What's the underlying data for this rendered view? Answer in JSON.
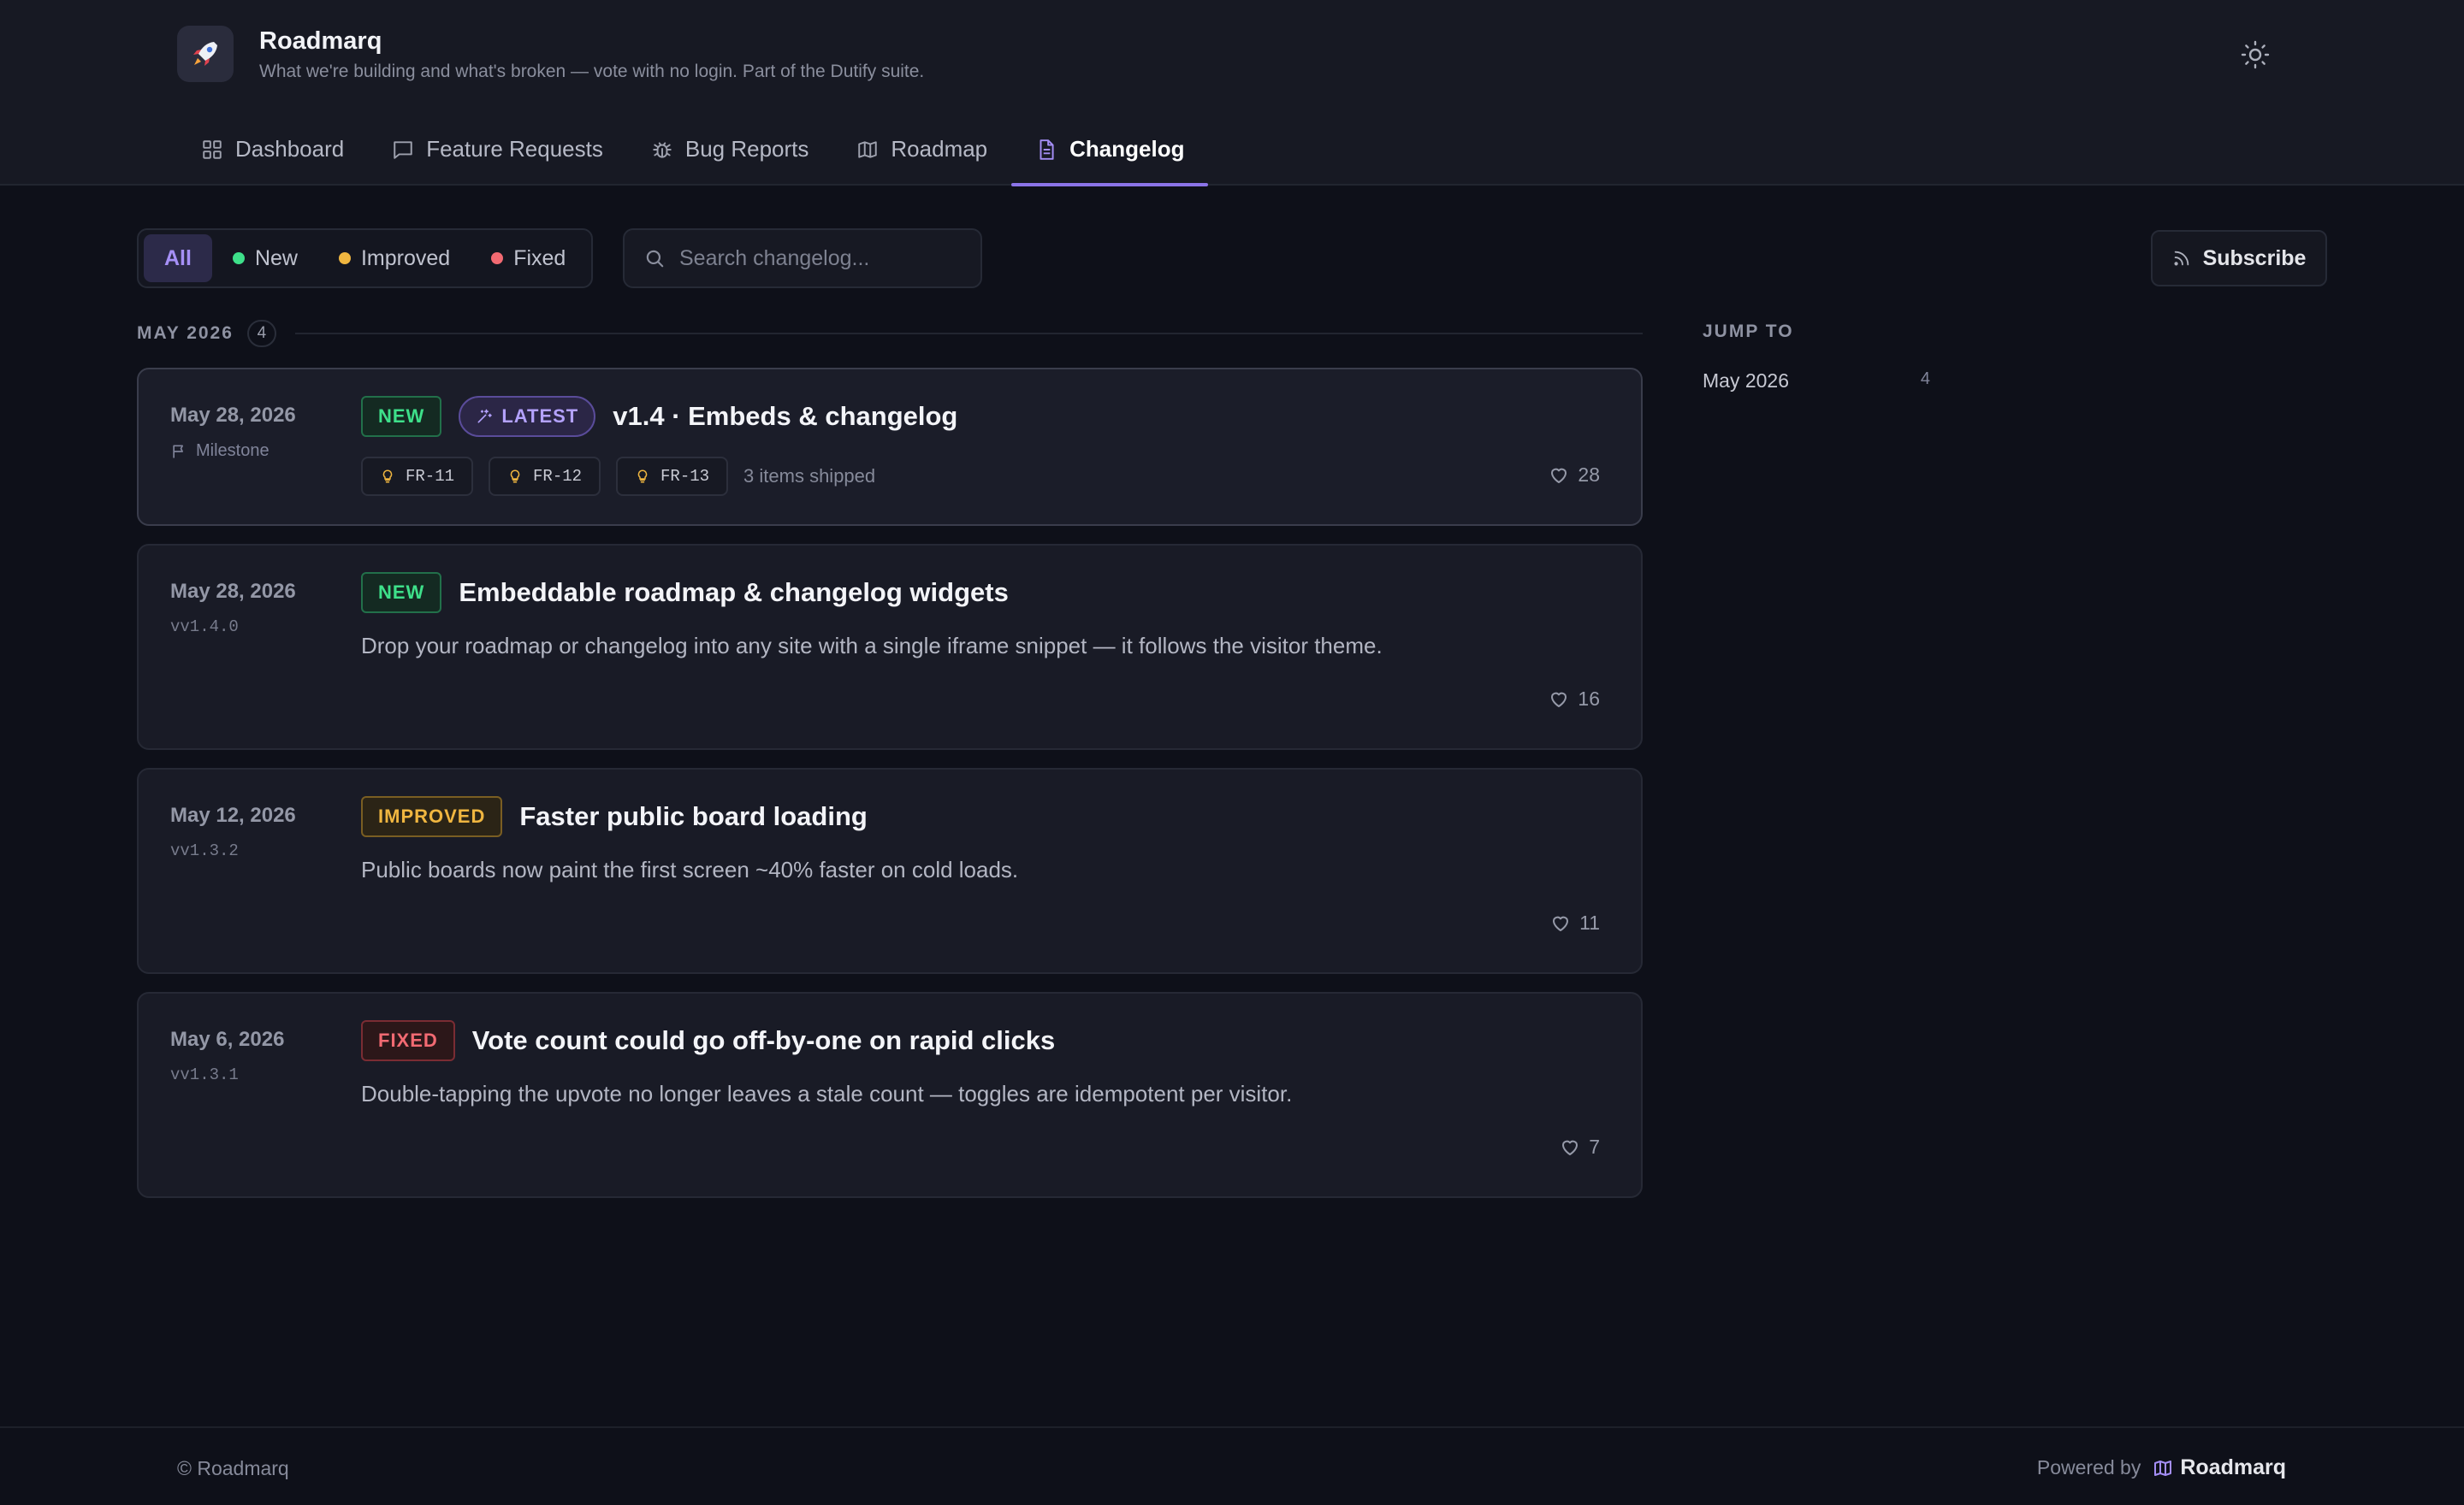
{
  "app": {
    "name": "Roadmarq",
    "tagline": "What we're building and what's broken — vote with no login. Part of the Dutify suite."
  },
  "nav": {
    "tabs": [
      {
        "label": "Dashboard",
        "icon": "grid-icon"
      },
      {
        "label": "Feature Requests",
        "icon": "message-icon"
      },
      {
        "label": "Bug Reports",
        "icon": "bug-icon"
      },
      {
        "label": "Roadmap",
        "icon": "map-icon"
      },
      {
        "label": "Changelog",
        "icon": "document-icon",
        "active": true
      }
    ]
  },
  "filters": {
    "all": "All",
    "new": "New",
    "improved": "Improved",
    "fixed": "Fixed",
    "active": "All"
  },
  "search": {
    "placeholder": "Search changelog...",
    "value": ""
  },
  "subscribe": {
    "label": "Subscribe"
  },
  "month": {
    "label": "MAY 2026",
    "count": "4"
  },
  "entries": [
    {
      "date": "May 28, 2026",
      "sub": "Milestone",
      "badge": "NEW",
      "latest": "LATEST",
      "title": "v1.4 · Embeds & changelog",
      "chips": [
        "FR-11",
        "FR-12",
        "FR-13"
      ],
      "shipped": "3 items shipped",
      "likes": "28"
    },
    {
      "date": "May 28, 2026",
      "sub": "vv1.4.0",
      "badge": "NEW",
      "title": "Embeddable roadmap & changelog widgets",
      "desc": "Drop your roadmap or changelog into any site with a single iframe snippet — it follows the visitor theme.",
      "likes": "16"
    },
    {
      "date": "May 12, 2026",
      "sub": "vv1.3.2",
      "badge": "IMPROVED",
      "title": "Faster public board loading",
      "desc": "Public boards now paint the first screen ~40% faster on cold loads.",
      "likes": "11"
    },
    {
      "date": "May 6, 2026",
      "sub": "vv1.3.1",
      "badge": "FIXED",
      "title": "Vote count could go off-by-one on rapid clicks",
      "desc": "Double-tapping the upvote no longer leaves a stale count — toggles are idempotent per visitor.",
      "likes": "7"
    }
  ],
  "sidebar": {
    "title": "JUMP TO",
    "items": [
      {
        "label": "May 2026",
        "count": "4"
      }
    ]
  },
  "footer": {
    "copyright": "© Roadmarq",
    "powered_by": "Powered by",
    "brand": "Roadmarq"
  },
  "colors": {
    "accent": "#8b74e8",
    "new": "#3ee08a",
    "improved": "#f0b640",
    "fixed": "#f26a72",
    "background": "#0e1019"
  }
}
